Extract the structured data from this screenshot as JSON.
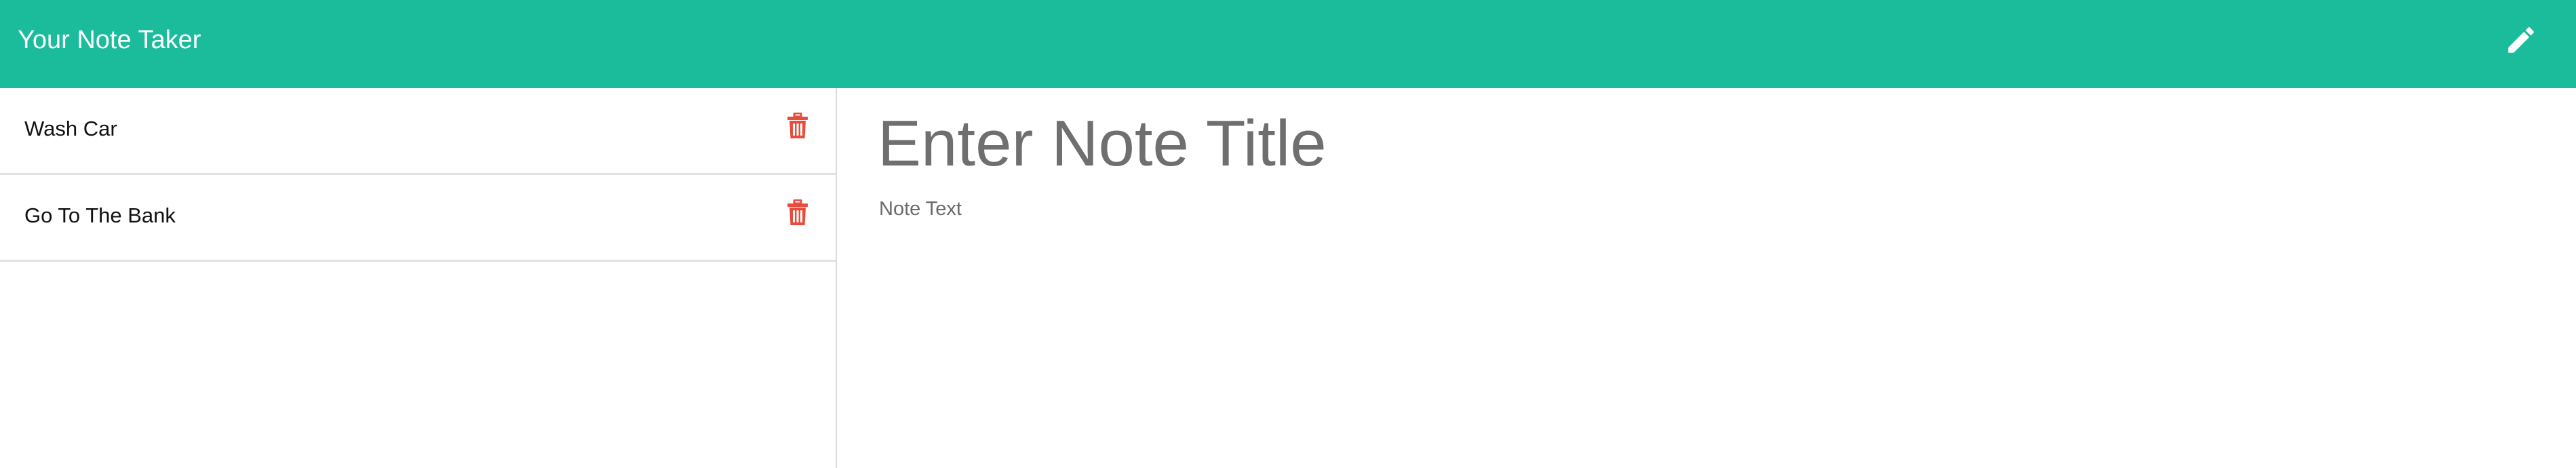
{
  "navbar": {
    "brand": "Your Note Taker",
    "new_note_icon": "pencil-icon",
    "background_color": "#1abc9c"
  },
  "notes": [
    {
      "title": "Wash Car",
      "delete_icon": "trash-icon"
    },
    {
      "title": "Go To The Bank",
      "delete_icon": "trash-icon"
    }
  ],
  "editor": {
    "title_placeholder": "Enter Note Title",
    "text_placeholder": "Note Text"
  },
  "colors": {
    "accent": "#1abc9c",
    "delete": "#e74c3c"
  }
}
